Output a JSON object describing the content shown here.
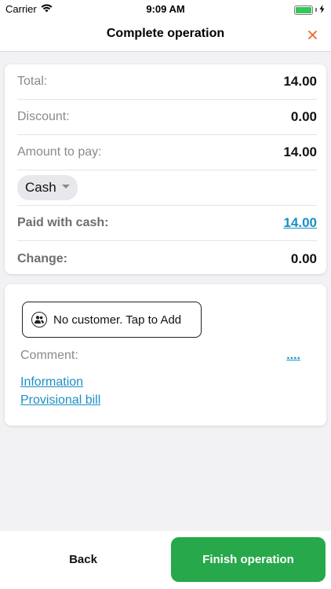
{
  "status_bar": {
    "carrier": "Carrier",
    "time": "9:09 AM",
    "icons": [
      "wifi-icon",
      "battery-icon",
      "charging-bolt-icon"
    ],
    "battery_level": 1.0
  },
  "nav": {
    "title": "Complete operation",
    "close_icon": "close-icon"
  },
  "summary": {
    "total_label": "Total:",
    "total_value": "14.00",
    "discount_label": "Discount:",
    "discount_value": "0.00",
    "amount_label": "Amount to pay:",
    "amount_value": "14.00",
    "payment_method": "Cash",
    "paid_label": "Paid with cash:",
    "paid_value": "14.00",
    "change_label": "Change:",
    "change_value": "0.00"
  },
  "customer": {
    "button_label": "No customer. Tap to Add",
    "comment_label": "Comment:",
    "comment_more": "....",
    "links": [
      "Information",
      "Provisional bill"
    ]
  },
  "footer": {
    "back_label": "Back",
    "finish_label": "Finish operation"
  },
  "colors": {
    "accent_orange": "#e8692c",
    "link_blue": "#1a8fc6",
    "finish_green": "#27a84a"
  }
}
